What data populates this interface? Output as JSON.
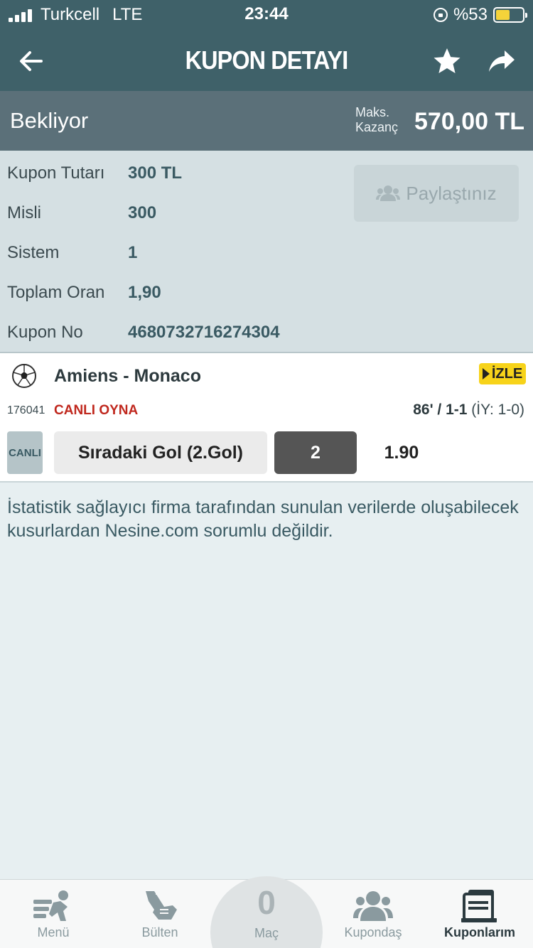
{
  "statusbar": {
    "carrier": "Turkcell",
    "network": "LTE",
    "time": "23:44",
    "battery": "%53",
    "battery_level": 0.53
  },
  "header": {
    "title": "KUPON DETAYI"
  },
  "coupon": {
    "state": "Bekliyor",
    "max_label_line1": "Maks.",
    "max_label_line2": "Kazanç",
    "max_value": "570,00 TL",
    "fields": [
      {
        "label": "Kupon Tutarı",
        "value": "300 TL"
      },
      {
        "label": "Misli",
        "value": "300"
      },
      {
        "label": "Sistem",
        "value": "1"
      },
      {
        "label": "Toplam Oran",
        "value": "1,90"
      },
      {
        "label": "Kupon No",
        "value": "4680732716274304"
      }
    ],
    "share_label": "Paylaştınız"
  },
  "match": {
    "teams": "Amiens - Monaco",
    "watch_label": "İZLE",
    "code": "176041",
    "live_play": "CANLI OYNA",
    "minute_score": "86' / 1-1",
    "half_time": " (İY: 1-0)",
    "live_badge": "CANLI",
    "market": "Sıradaki Gol (2.Gol)",
    "pick": "2",
    "odd": "1.90"
  },
  "disclaimer": "İstatistik sağlayıcı firma tarafından sunulan verilerde oluşabilecek kusurlardan Nesine.com sorumlu değildir.",
  "tabbar": {
    "menu": "Menü",
    "bulten": "Bülten",
    "mac_count": "0",
    "mac": "Maç",
    "kupondas": "Kupondaş",
    "kuponlarim": "Kuponlarım"
  },
  "colors": {
    "header": "#3f6169",
    "status_band": "#5b7079",
    "info_bg": "#d5e0e3",
    "live_red": "#c0281e",
    "watch_yellow": "#f7d31a"
  }
}
